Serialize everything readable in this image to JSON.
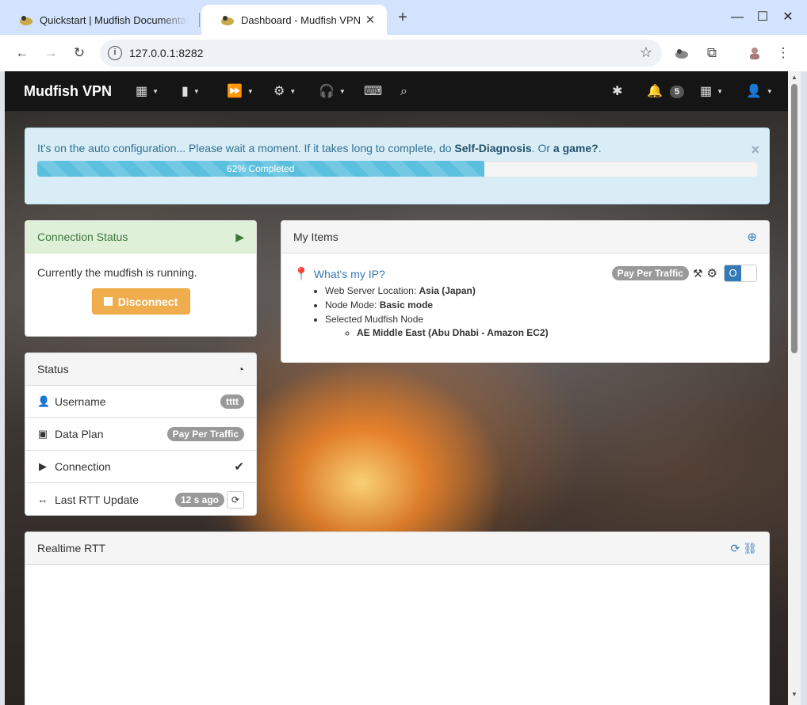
{
  "browser": {
    "tabs": [
      {
        "title": "Quickstart | Mudfish Documentation",
        "active": false
      },
      {
        "title": "Dashboard - Mudfish VPN",
        "active": true
      }
    ],
    "url": "127.0.0.1:8282"
  },
  "navbar": {
    "brand": "Mudfish VPN",
    "notifications_count": "5"
  },
  "alert": {
    "text_prefix": "It's on the auto configuration... Please wait a moment. If it takes long to complete, do ",
    "self_diagnosis": "Self-Diagnosis",
    "text_or": ". Or ",
    "game": "a game?",
    "text_end": ".",
    "progress_label": "62% Completed",
    "progress_percent": 62
  },
  "connection_status": {
    "title": "Connection Status",
    "message": "Currently the mudfish is running.",
    "disconnect_label": "Disconnect"
  },
  "status": {
    "title": "Status",
    "rows": [
      {
        "label": "Username",
        "value": "tttt"
      },
      {
        "label": "Data Plan",
        "value": "Pay Per Traffic"
      },
      {
        "label": "Connection",
        "value": ""
      },
      {
        "label": "Last RTT Update",
        "value": "12 s ago"
      }
    ]
  },
  "my_items": {
    "title": "My Items",
    "item": {
      "name": "What's my IP?",
      "plan_badge": "Pay Per Traffic",
      "toggle_label": "O",
      "web_server_location_label": "Web Server Location: ",
      "web_server_location": "Asia (Japan)",
      "node_mode_label": "Node Mode: ",
      "node_mode": "Basic mode",
      "selected_node_label": "Selected Mudfish Node",
      "selected_node": "AE Middle East (Abu Dhabi - Amazon EC2)"
    }
  },
  "realtime_rtt": {
    "title": "Realtime RTT"
  },
  "colors": {
    "navbar": "#151515",
    "alert_bg": "#d9edf7",
    "progress": "#5bc0de",
    "success_heading": "#dff0d8",
    "warning_button": "#f0ad4e",
    "primary": "#337ab7"
  }
}
